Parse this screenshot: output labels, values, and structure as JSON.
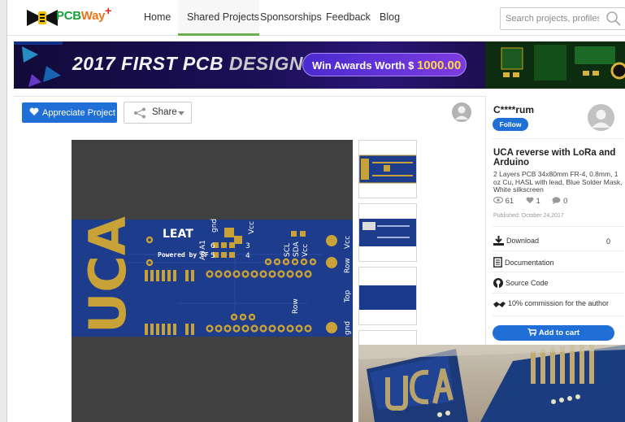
{
  "nav": {
    "brand_prefix": "PCB",
    "brand_suffix": "Way",
    "brand_plus": "+",
    "links": [
      "Home",
      "Shared Projects",
      "Sponsorships",
      "Feedback",
      "Blog"
    ],
    "search_placeholder": "Search projects, profiles ..."
  },
  "banner": {
    "title_a": "2017 FIRST PCB",
    "title_b": "DESIGN CONTEST",
    "pill_text": "Win Awards Worth $",
    "pill_amount": "1000.00"
  },
  "toolbar": {
    "appreciate_label": "Appreciate Project",
    "share_label": "Share"
  },
  "author": {
    "name": "C****rum",
    "follow_label": "Follow"
  },
  "project": {
    "title": "UCA reverse with LoRa and Arduino",
    "description": "2 Layers PCB 34x80mm FR-4, 0.8mm, 1 oz Cu, HASL with lead, Blue Solder Mask, White silkscreen",
    "views": "61",
    "likes": "1",
    "comments": "0",
    "published": "Published: October 24,2017"
  },
  "sidebar": {
    "download_label": "Download",
    "download_count": "0",
    "documentation_label": "Documentation",
    "source_label": "Source Code",
    "commission_label": "10% commission for the author",
    "cart_label": "Add to cart"
  },
  "pcb": {
    "logo_text": "UCA",
    "leat_text": "LEAT",
    "powered_text": "Powered by FF",
    "labels": [
      "gnd",
      "Vcc",
      "A1",
      "A0",
      "6",
      "5",
      "3",
      "4",
      "SCL",
      "SDA",
      "Vcc",
      "Row",
      "Vcc",
      "Row",
      "Top",
      "gnd"
    ]
  },
  "colors": {
    "accent": "#1f6fd6",
    "nav_active_bar": "#6ab04c",
    "pcb_blue": "#1e3c8c",
    "pcb_gold": "#c8a236"
  }
}
